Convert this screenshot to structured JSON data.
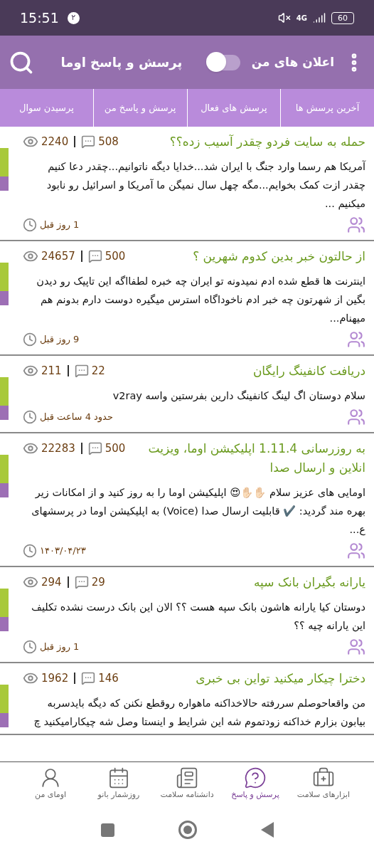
{
  "status_bar": {
    "time": "15:51",
    "badge": "۲",
    "network": "4G",
    "battery": "60"
  },
  "header": {
    "title": "پرسش و پاسخ اوما",
    "notifications_label": "اعلان های من",
    "notifications_on": false
  },
  "tabs": [
    {
      "label": "آخرین پرسش ها"
    },
    {
      "label": "پرسش های فعال"
    },
    {
      "label": "پرسش و پاسخ من"
    },
    {
      "label": "پرسیدن سوال"
    }
  ],
  "posts": [
    {
      "title": "حمله به سایت فردو چقدر آسیب زده؟؟",
      "comments": "508",
      "views": "2240",
      "body": "آمریکا هم رسما وارد جنگ با ایران شد...خدایا دیگه ناتوانیم...چقدر دعا کنیم چقدر ازت کمک بخوایم...مگه چهل سال نمیگن ما  آمریکا و اسرائیل رو نابود میکنیم ...",
      "time": "1 روز قبل"
    },
    {
      "title": "از حالتون خبر بدین کدوم شهرین ؟",
      "comments": "500",
      "views": "24657",
      "body": "اینترنت ها قطع شده ادم نمیدونه تو ایران چه خبره لطفااگه این تاپیک رو دیدن بگین از شهرتون چه خبر  ادم ناخوداگاه استرس میگیره دوست دارم بدونم هم میهنام...",
      "time": "9 روز قبل"
    },
    {
      "title": "دریافت کانفینگ رایگان",
      "comments": "22",
      "views": "211",
      "body": "سلام دوستان اگ لینگ کانفینگ دارین بفرستین واسه v2ray",
      "time": "حدود 4 ساعت قبل"
    },
    {
      "title": "به روزرسانی 1.11.4 اپلیکیشن اوما، ویزیت انلاین و ارسال صدا",
      "comments": "500",
      "views": "22283",
      "body": "اومایی های عزیز سلام ✋🏻✋🏻😍 اپلیکیشن اوما را به روز کنید و از امکانات زیر بهره مند گردید:  ✔️ قابلیت ارسال صدا (Voice) به اپلیکیشن اوما در پرسشهای ع...",
      "time": "۱۴۰۳/۰۴/۲۳"
    },
    {
      "title": "یارانه بگیران بانک سپه",
      "comments": "29",
      "views": "294",
      "body": "دوستان کیا یارانه هاشون بانک سپه هست ؟؟  الان این بانک درست نشده تکلیف این یارانه چیه ؟؟",
      "time": "1 روز قبل"
    },
    {
      "title": "دخترا چیکار میکنید تواین بی خبری",
      "comments": "146",
      "views": "1962",
      "body": "من واقعاحوصلم سررفته حالاخداکنه ماهواره روقطع نکنن که دیگه بایدسربه بیابون بزارم خداکنه زودتموم شه این شرایط و اینستا وصل شه چیکارامیکنید چ"
    }
  ],
  "bottom_nav": [
    {
      "label": "ابزارهای سلامت",
      "kind": "kit",
      "selected": false
    },
    {
      "label": "پرسش و پاسخ",
      "kind": "question",
      "selected": true
    },
    {
      "label": "دانشنامه سلامت",
      "kind": "news",
      "selected": false
    },
    {
      "label": "روزشمار بانو",
      "kind": "calendar",
      "selected": false
    },
    {
      "label": "اومای من",
      "kind": "user",
      "selected": false
    }
  ]
}
